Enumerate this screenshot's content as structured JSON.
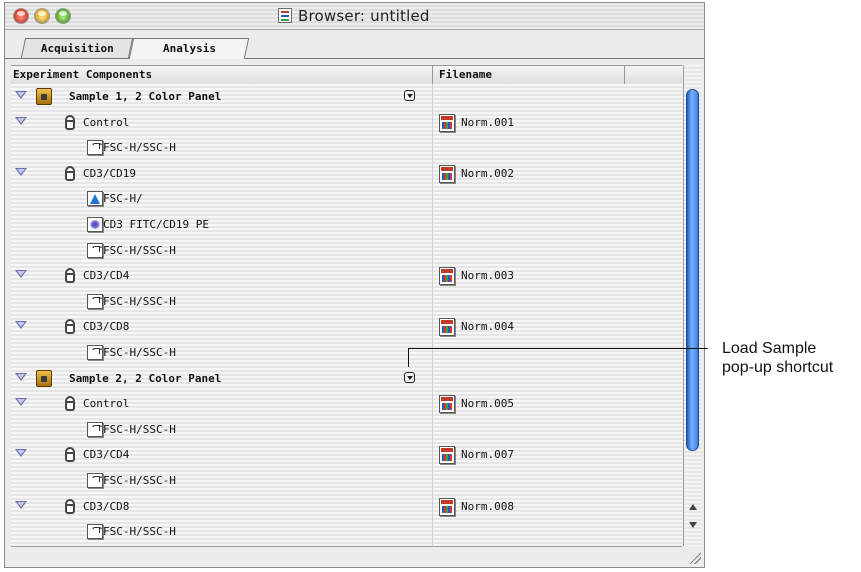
{
  "window": {
    "title": "Browser: untitled"
  },
  "tabs": [
    {
      "label": "Acquisition"
    },
    {
      "label": "Analysis"
    }
  ],
  "columns": {
    "components": "Experiment Components",
    "filename": "Filename"
  },
  "rows": [
    {
      "label": "Sample 1, 2 Color Panel",
      "filename": "",
      "icon": "panel-folder-icon",
      "level": 0,
      "expanded": true,
      "bold": true,
      "popup": true
    },
    {
      "label": "Control",
      "filename": "Norm.001",
      "icon": "tube-icon",
      "level": 1,
      "expanded": true,
      "bold": false,
      "popup": false
    },
    {
      "label": "FSC-H/SSC-H",
      "filename": "",
      "icon": "dot-plot-icon",
      "level": 2,
      "expanded": false,
      "bold": false,
      "popup": false
    },
    {
      "label": "CD3/CD19",
      "filename": "Norm.002",
      "icon": "tube-icon",
      "level": 1,
      "expanded": true,
      "bold": false,
      "popup": false
    },
    {
      "label": "FSC-H/",
      "filename": "",
      "icon": "histogram-icon",
      "level": 2,
      "expanded": false,
      "bold": false,
      "popup": false
    },
    {
      "label": "CD3 FITC/CD19 PE",
      "filename": "",
      "icon": "contour-plot-icon",
      "level": 2,
      "expanded": false,
      "bold": false,
      "popup": false
    },
    {
      "label": "FSC-H/SSC-H",
      "filename": "",
      "icon": "dot-plot-icon",
      "level": 2,
      "expanded": false,
      "bold": false,
      "popup": false
    },
    {
      "label": "CD3/CD4",
      "filename": "Norm.003",
      "icon": "tube-icon",
      "level": 1,
      "expanded": true,
      "bold": false,
      "popup": false
    },
    {
      "label": "FSC-H/SSC-H",
      "filename": "",
      "icon": "dot-plot-icon",
      "level": 2,
      "expanded": false,
      "bold": false,
      "popup": false
    },
    {
      "label": "CD3/CD8",
      "filename": "Norm.004",
      "icon": "tube-icon",
      "level": 1,
      "expanded": true,
      "bold": false,
      "popup": false
    },
    {
      "label": "FSC-H/SSC-H",
      "filename": "",
      "icon": "dot-plot-icon",
      "level": 2,
      "expanded": false,
      "bold": false,
      "popup": false
    },
    {
      "label": "Sample 2, 2 Color Panel",
      "filename": "",
      "icon": "panel-folder-icon",
      "level": 0,
      "expanded": true,
      "bold": true,
      "popup": true
    },
    {
      "label": "Control",
      "filename": "Norm.005",
      "icon": "tube-icon",
      "level": 1,
      "expanded": true,
      "bold": false,
      "popup": false
    },
    {
      "label": "FSC-H/SSC-H",
      "filename": "",
      "icon": "dot-plot-icon",
      "level": 2,
      "expanded": false,
      "bold": false,
      "popup": false
    },
    {
      "label": "CD3/CD4",
      "filename": "Norm.007",
      "icon": "tube-icon",
      "level": 1,
      "expanded": true,
      "bold": false,
      "popup": false
    },
    {
      "label": "FSC-H/SSC-H",
      "filename": "",
      "icon": "dot-plot-icon",
      "level": 2,
      "expanded": false,
      "bold": false,
      "popup": false
    },
    {
      "label": "CD3/CD8",
      "filename": "Norm.008",
      "icon": "tube-icon",
      "level": 1,
      "expanded": true,
      "bold": false,
      "popup": false
    },
    {
      "label": "FSC-H/SSC-H",
      "filename": "",
      "icon": "dot-plot-icon",
      "level": 2,
      "expanded": false,
      "bold": false,
      "popup": false
    }
  ],
  "callout": {
    "line1": "Load Sample",
    "line2": "pop-up shortcut"
  }
}
